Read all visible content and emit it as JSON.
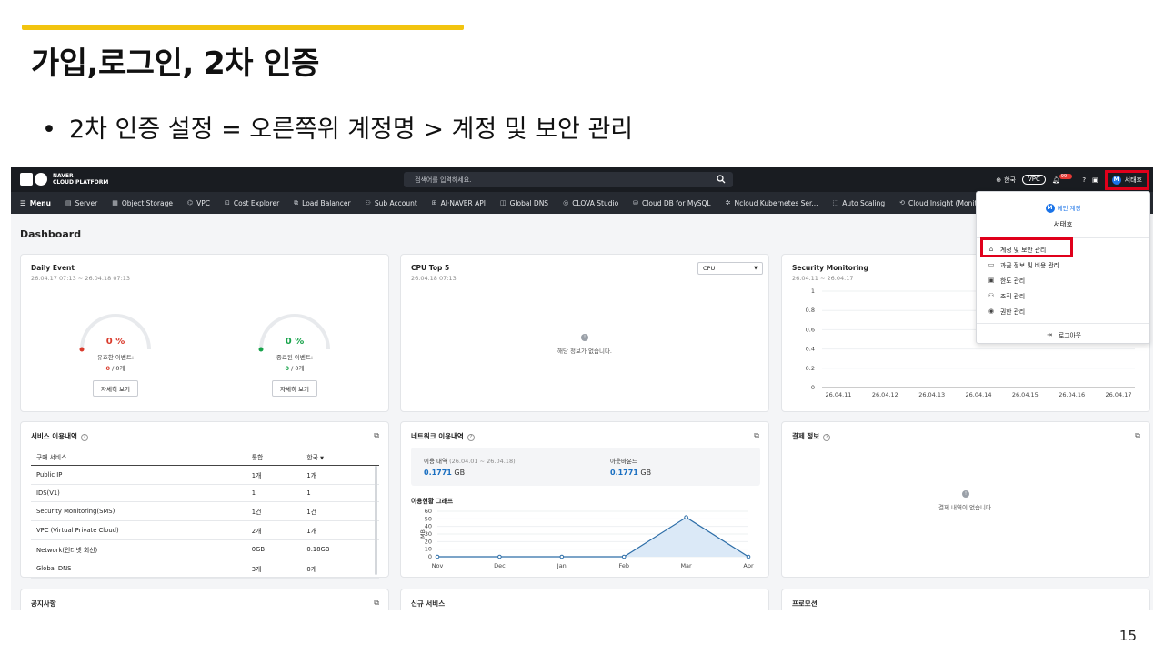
{
  "slide": {
    "title": "가입,로그인, 2차 인증",
    "bullet": "2차 인증 설정 = 오른쪽위 계정명 > 계정 및 보안 관리",
    "page_number": "15",
    "accent_color": "#f2c40f"
  },
  "topbar": {
    "logo_line1": "NAVER",
    "logo_line2": "CLOUD PLATFORM",
    "search_placeholder": "검색어를 입력하세요.",
    "language": "한국",
    "platform": "VPC",
    "notification_badge": "99+",
    "user_name": "서태호",
    "avatar_letter": "M",
    "highlight_color": "#e0001b"
  },
  "menubar": {
    "main": "Menu",
    "items": [
      "Server",
      "Object Storage",
      "VPC",
      "Cost Explorer",
      "Load Balancer",
      "Sub Account",
      "AI·NAVER API",
      "Global DNS",
      "CLOVA Studio",
      "Cloud DB for MySQL",
      "Ncloud Kubernetes Ser...",
      "Auto Scaling",
      "Cloud Insight (Monit"
    ]
  },
  "dashboard": {
    "title": "Dashboard",
    "daily_event": {
      "title": "Daily Event",
      "period": "26.04.17 07:13 ~ 26.04.18 07:13",
      "gauges": [
        {
          "value": "0 %",
          "label": "유효한 이벤트:",
          "count_value": "0",
          "count_rest": " / 0개",
          "button": "자세히 보기",
          "color": "#d93a2b"
        },
        {
          "value": "0 %",
          "label": "종료된 이벤트:",
          "count_value": "0",
          "count_rest": " / 0개",
          "button": "자세히 보기",
          "color": "#17a34a"
        }
      ]
    },
    "cpu_top5": {
      "title": "CPU Top 5",
      "date": "26.04.18 07:13",
      "select_value": "CPU",
      "empty_icon": "!",
      "empty_message": "해당 정보가 없습니다."
    },
    "security": {
      "title": "Security Monitoring",
      "period": "26.04.11 ~ 26.04.17"
    },
    "service_usage": {
      "title": "서비스 이용내역",
      "headers": [
        "구매 서비스",
        "통합",
        "한국"
      ],
      "rows": [
        [
          "Public IP",
          "1개",
          "1개"
        ],
        [
          "IDS(V1)",
          "1",
          "1"
        ],
        [
          "Security Monitoring(SMS)",
          "1건",
          "1건"
        ],
        [
          "VPC (Virtual Private Cloud)",
          "2개",
          "1개"
        ],
        [
          "Network(인터넷 회선)",
          "0GB",
          "0.18GB"
        ],
        [
          "Global DNS",
          "3개",
          "0개"
        ]
      ]
    },
    "network": {
      "title": "네트워크 이용내역",
      "usage_label": "이용 내역",
      "usage_period": "(26.04.01 ~ 26.04.18)",
      "usage_value": "0.1771",
      "usage_unit": "GB",
      "outbound_label": "아웃바운드",
      "outbound_value": "0.1771",
      "outbound_unit": "GB",
      "chart_title": "이용현황 그래프"
    },
    "billing": {
      "title": "결제 정보",
      "empty_icon": "!",
      "empty_message": "결제 내역이 없습니다."
    },
    "bottom_cards": [
      "공지사항",
      "신규 서비스",
      "프로모션"
    ]
  },
  "dropdown": {
    "header": "메인 계정",
    "name": "서태호",
    "items": [
      "계정 및 보안 관리",
      "과금 정보 및 비용 관리",
      "한도 관리",
      "조직 관리",
      "권한 관리"
    ],
    "logout": "로그아웃"
  },
  "chart_data": [
    {
      "type": "line",
      "title": "Security Monitoring",
      "x": [
        "26.04.11",
        "26.04.12",
        "26.04.13",
        "26.04.14",
        "26.04.15",
        "26.04.16",
        "26.04.17"
      ],
      "yticks": [
        "0",
        "0.2",
        "0.4",
        "0.6",
        "0.8",
        "1"
      ],
      "ylim": [
        0,
        1
      ],
      "series": []
    },
    {
      "type": "area",
      "title": "이용현황 그래프",
      "x": [
        "Nov",
        "Dec",
        "Jan",
        "Feb",
        "Mar",
        "Apr"
      ],
      "yticks": [
        "0",
        "10",
        "20",
        "30",
        "40",
        "50",
        "60"
      ],
      "ylabel": "MB",
      "ylim": [
        0,
        60
      ],
      "values": [
        0,
        0,
        0,
        0,
        52,
        0
      ],
      "line_color": "#2d6ea8",
      "fill_color": "#dbe9f7"
    }
  ]
}
